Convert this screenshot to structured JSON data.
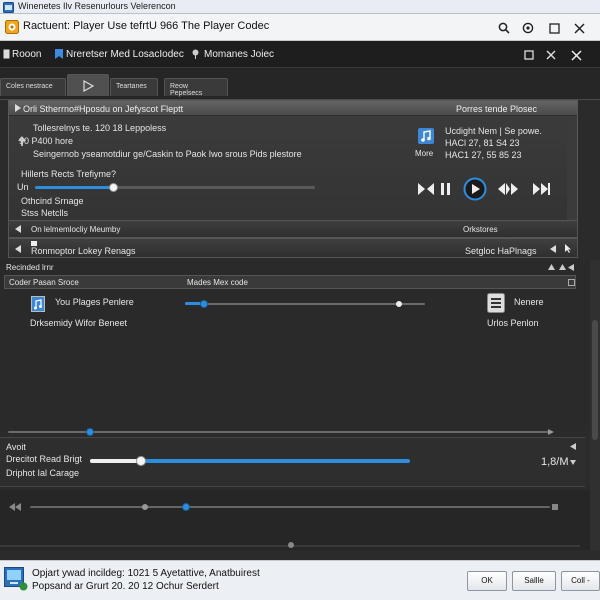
{
  "os_bar": {
    "title": "Winenetes Ilv Resenurlours Velerencon"
  },
  "window": {
    "title": "Ractuent: Player Use tefrtU  966 The Player Codec"
  },
  "menu": {
    "app_name": "Rooon",
    "item1": "Nreretser Med LosacIodec",
    "item2": "Momanes Joiec"
  },
  "tabs": [
    "Coles nestrace",
    "",
    "Teartanes",
    "Reow Pepelsecs"
  ],
  "panel1": {
    "header_left": "Orli Stherrno#Hposdu on Jefyscot Fleptt",
    "header_right": "Porres tende Plosec",
    "line1": "Tollesrelnys te. 120 18  Leppoless",
    "line2": "90 P400 hore",
    "line3": "Seingernob yseamotdiur ge/Caskin to Paok Iwo srous Pids plestore",
    "line4": "Hillerts Rects Trefiyme?",
    "slider_label": "Un",
    "slider_value_pct": 28,
    "line5": "Othcind Srnage",
    "line6": "Stss Netclls",
    "track_line1": "Ucdight Nem | Se powe.",
    "track_line2": "HACl 27, 81 S4 23",
    "track_line3": "HAC1 27, 55 85 23",
    "more_label": "More",
    "row1_left": "On lelmemlocliy Meumby",
    "row1_right": "Orkstores",
    "row2_left": "Ronmoptor Lokey Renags",
    "row2_right": "Setgloc HaPlnags"
  },
  "section2": {
    "title": "Recinded lrnr",
    "col1": "Coder Pasan Sroce",
    "col2": "Mades Mex code",
    "item1_name": "You Plages Penlere",
    "item1_sub": "Drksemidy Wifor Beneet",
    "item1_slider_pct": 8,
    "item2_name": "Nenere",
    "item2_sub": "Urlos Penlon",
    "seek_pct": 15
  },
  "section3": {
    "line1": "Avoit",
    "line2": "Drecitot Read Brigt",
    "line3": "Driphot Ial Carage",
    "level_pct": 16,
    "readout": "1,8/M"
  },
  "bottom_strip": {
    "slider_pct": 30
  },
  "status": {
    "line1": "Opjart ywad incildeg: 1021 5 Ayetattive, Anatbuirest",
    "line2": "Popsand ar Grurt 20. 20 12 Ochur Serdert",
    "ok": "OK",
    "cancel": "Sallle",
    "third": "Coll -"
  }
}
